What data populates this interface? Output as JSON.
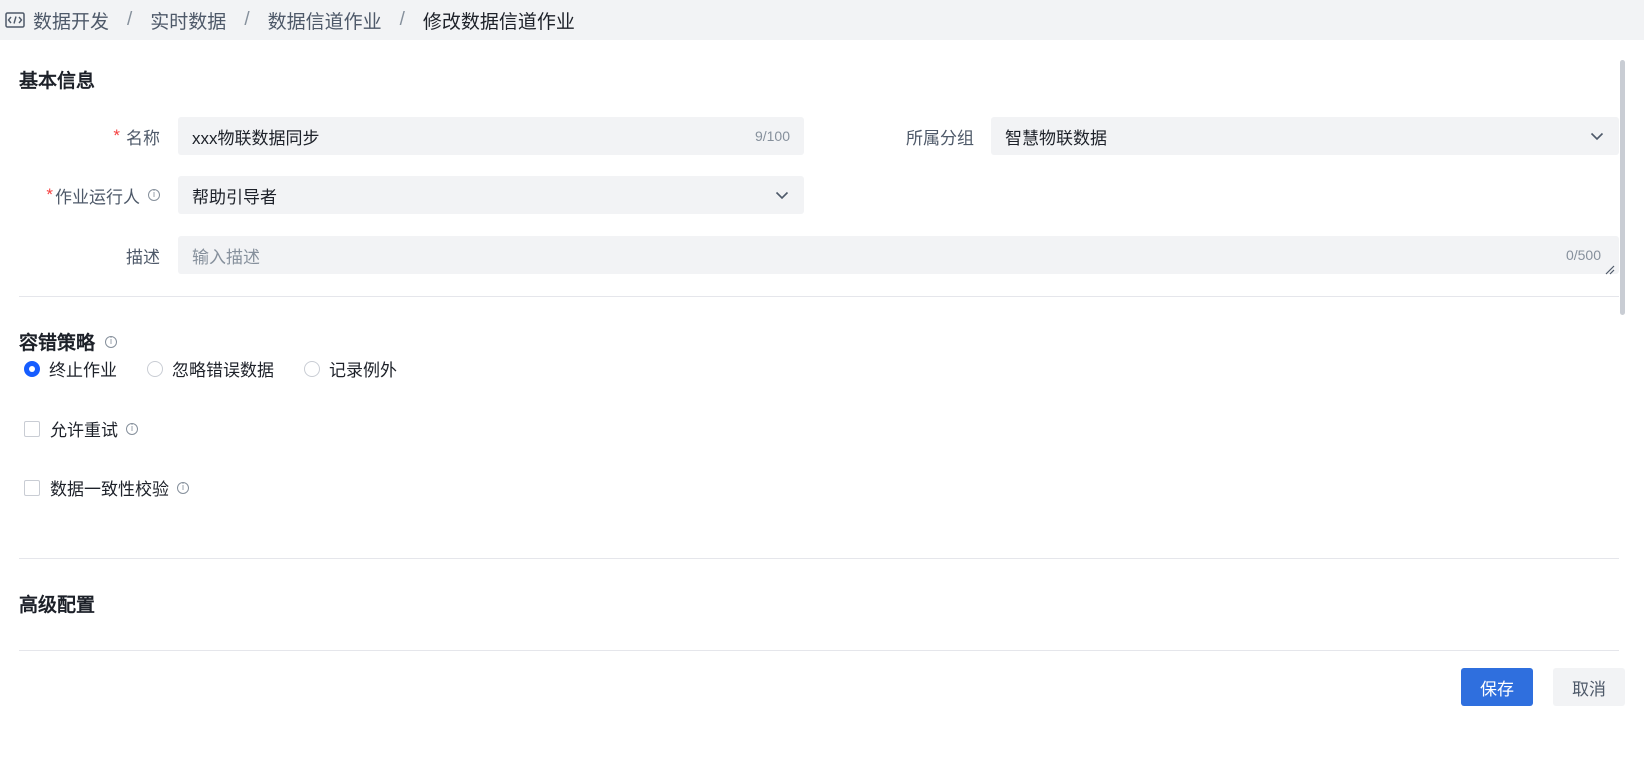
{
  "breadcrumb": {
    "items": [
      "数据开发",
      "实时数据",
      "数据信道作业",
      "修改数据信道作业"
    ],
    "separator": "/"
  },
  "sections": {
    "basic": "基本信息",
    "fault": "容错策略",
    "advanced": "高级配置"
  },
  "form": {
    "name": {
      "label": "名称",
      "required_mark": "*",
      "value": "xxx物联数据同步",
      "counter": "9/100"
    },
    "group": {
      "label": "所属分组",
      "value": "智慧物联数据"
    },
    "runner": {
      "label": "作业运行人",
      "required_mark": "*",
      "value": "帮助引导者"
    },
    "desc": {
      "label": "描述",
      "placeholder": "输入描述",
      "counter": "0/500"
    }
  },
  "fault_strategy": {
    "options": [
      "终止作业",
      "忽略错误数据",
      "记录例外"
    ],
    "selected": "终止作业"
  },
  "checkboxes": {
    "retry": {
      "label": "允许重试",
      "checked": false
    },
    "consistency": {
      "label": "数据一致性校验",
      "checked": false
    }
  },
  "actions": {
    "save": "保存",
    "cancel": "取消"
  },
  "colors": {
    "primary": "#2f6fde",
    "required": "#f53f3f",
    "field_bg": "#f2f3f5"
  }
}
